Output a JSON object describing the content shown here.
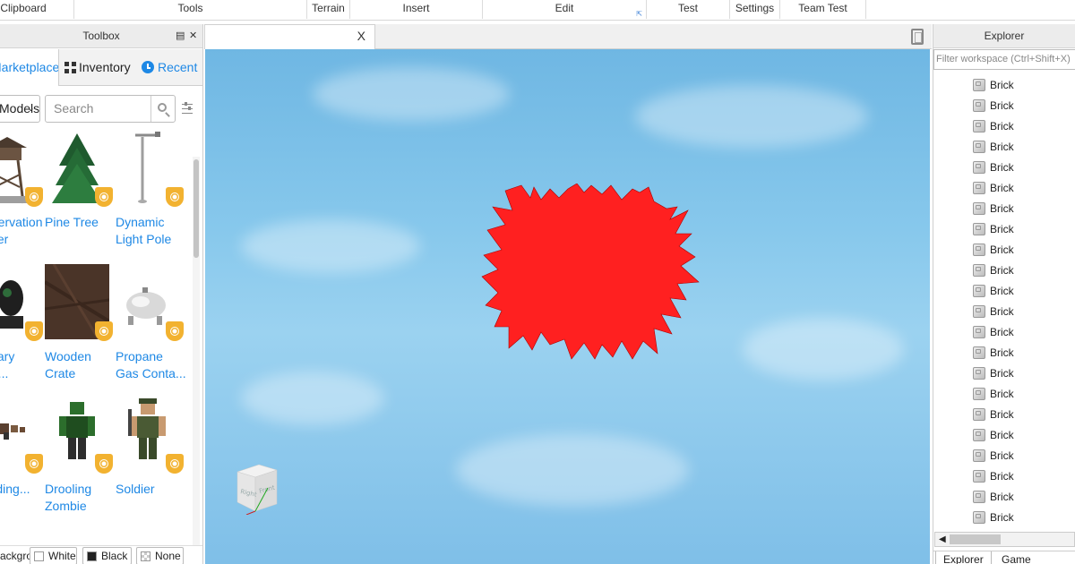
{
  "ribbon": {
    "sections": [
      {
        "label": "Clipboard"
      },
      {
        "label": "Tools"
      },
      {
        "label": "Terrain"
      },
      {
        "label": "Insert"
      },
      {
        "label": "Edit"
      },
      {
        "label": "Test"
      },
      {
        "label": "Settings"
      },
      {
        "label": "Team Test"
      }
    ]
  },
  "toolbox": {
    "title": "Toolbox",
    "tabs": {
      "marketplace": "Marketplace",
      "inventory": "Inventory",
      "recent": "Recent"
    },
    "category": "Models",
    "search_placeholder": "Search",
    "items": [
      {
        "name": "Observation Tower",
        "icon": "observation-tower"
      },
      {
        "name": "Pine Tree",
        "icon": "pine-tree"
      },
      {
        "name": "Dynamic Light Pole",
        "icon": "light-pole"
      },
      {
        "name": "Military Gas...",
        "icon": "gas-mask"
      },
      {
        "name": "Wooden Crate",
        "icon": "wooden-crate"
      },
      {
        "name": "Propane Gas Conta...",
        "icon": "propane-tank"
      },
      {
        "name": "Building...",
        "icon": "building"
      },
      {
        "name": "Drooling Zombie",
        "icon": "zombie"
      },
      {
        "name": "Soldier",
        "icon": "soldier"
      }
    ],
    "background": {
      "label": "Background:",
      "options": [
        "White",
        "Black",
        "None"
      ]
    }
  },
  "viewport": {
    "close_glyph": "X",
    "cube_labels": {
      "left": "Right",
      "right": "Front"
    }
  },
  "explorer": {
    "title": "Explorer",
    "filter_placeholder": "Filter workspace (Ctrl+Shift+X)",
    "items": [
      "Brick",
      "Brick",
      "Brick",
      "Brick",
      "Brick",
      "Brick",
      "Brick",
      "Brick",
      "Brick",
      "Brick",
      "Brick",
      "Brick",
      "Brick",
      "Brick",
      "Brick",
      "Brick",
      "Brick",
      "Brick",
      "Brick",
      "Brick",
      "Brick",
      "Brick"
    ],
    "bottom_tabs": [
      "Explorer",
      "Game"
    ]
  },
  "colors": {
    "accent_blue": "#1e88e5",
    "part_red": "#ff2020",
    "badge_gold": "#f2b230"
  }
}
